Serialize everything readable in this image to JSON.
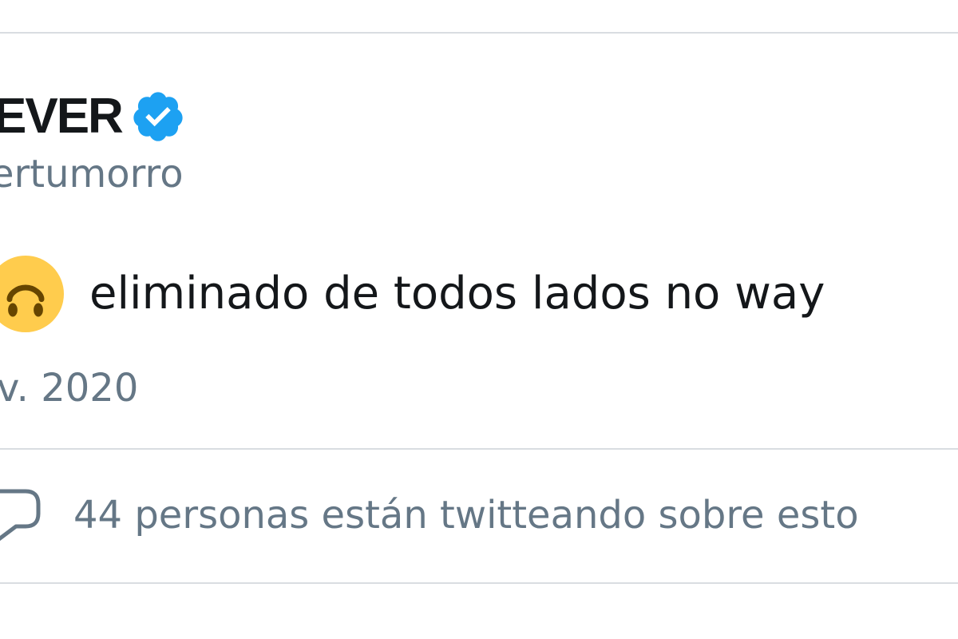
{
  "tweet": {
    "display_name": "EVER",
    "handle": "ertumorro",
    "text": "eliminado de todos lados no way",
    "date": "v. 2020",
    "emoji": "upside-down-face-icon",
    "verified": true
  },
  "conversation": {
    "label": "44 personas están twitteando sobre esto",
    "icon": "speech-bubble-icon"
  },
  "colors": {
    "verified_blue": "#1da1f2",
    "primary_text": "#14171a",
    "secondary_text": "#657786",
    "divider": "#d9dde1",
    "emoji_yellow": "#ffcc4d"
  }
}
